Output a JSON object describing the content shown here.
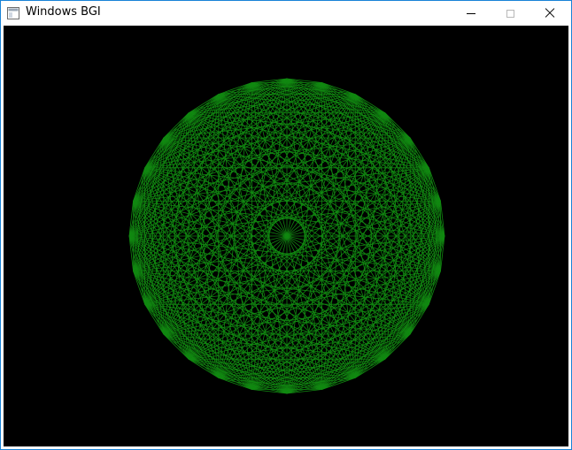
{
  "window": {
    "title": "Windows BGI",
    "icon": "window-app-icon",
    "controls": [
      "minimize-icon",
      "maximize-icon",
      "close-icon"
    ]
  },
  "drawing": {
    "background": "#000000",
    "stroke_color": "#118811",
    "vertex_count": 28,
    "shape": "complete graph (all vertices connected) inscribed in a circle"
  }
}
